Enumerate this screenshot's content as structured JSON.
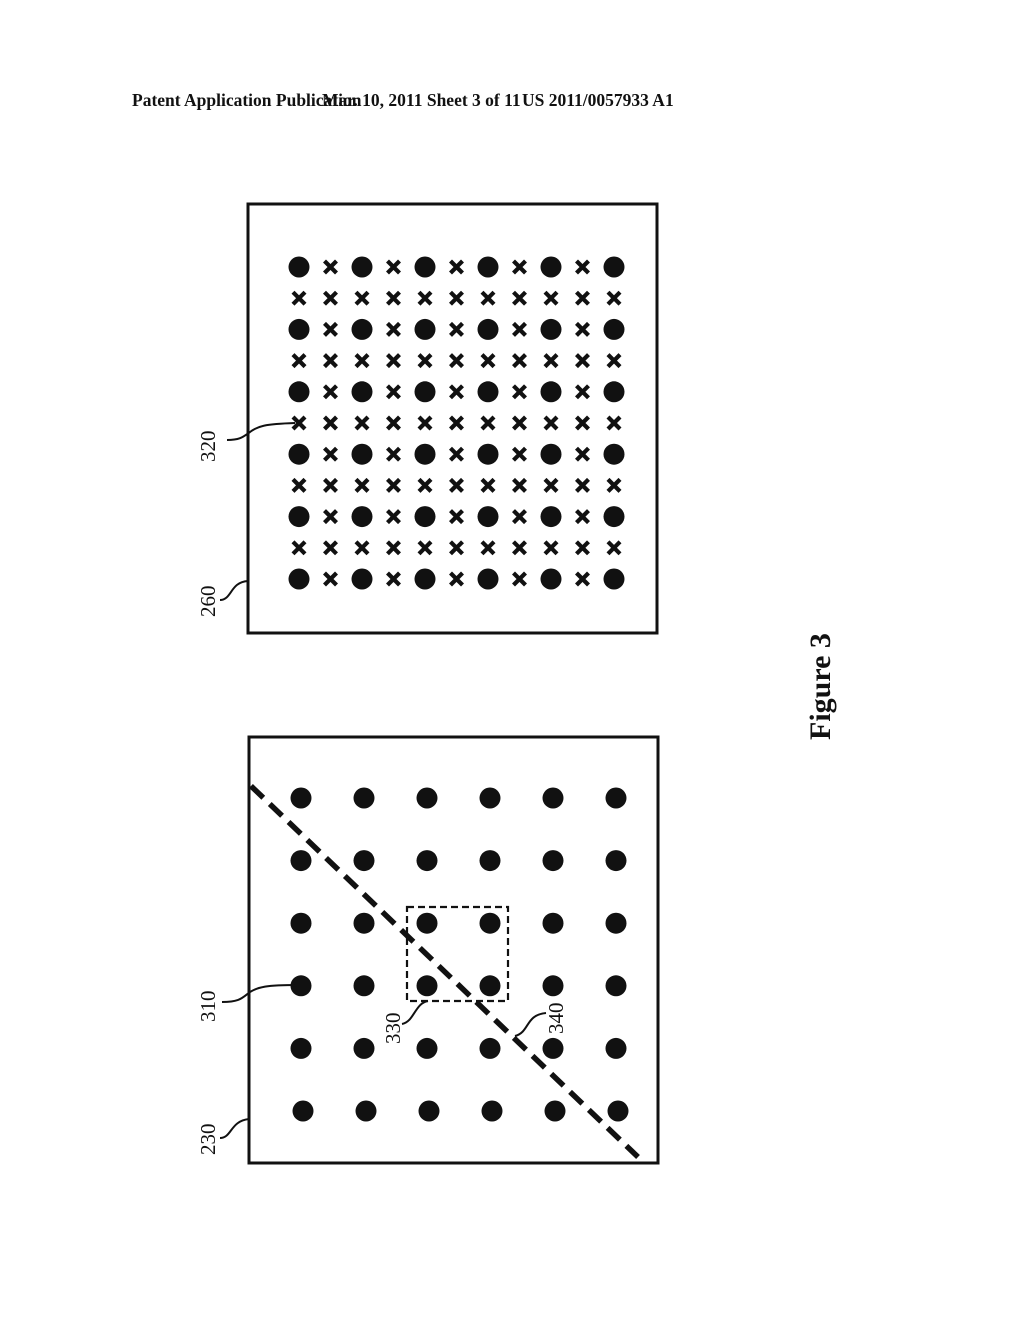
{
  "header": {
    "publication": "Patent Application Publication",
    "date_sheet": "Mar. 10, 2011  Sheet 3 of 11",
    "number": "US 2011/0057933 A1"
  },
  "figure_label": "Figure 3",
  "top_panel": {
    "ref": "260",
    "grid_ref": "320",
    "grid_rows": 11,
    "grid_cols": 11,
    "pattern": "even rows alternate dot/cross starting with dot; odd rows all crosses"
  },
  "bottom_panel": {
    "ref": "230",
    "dot_ref": "310",
    "window_ref": "330",
    "line_ref": "340",
    "grid_rows": 6,
    "grid_cols": 6
  },
  "colors": {
    "ink": "#111111",
    "paper": "#ffffff"
  }
}
